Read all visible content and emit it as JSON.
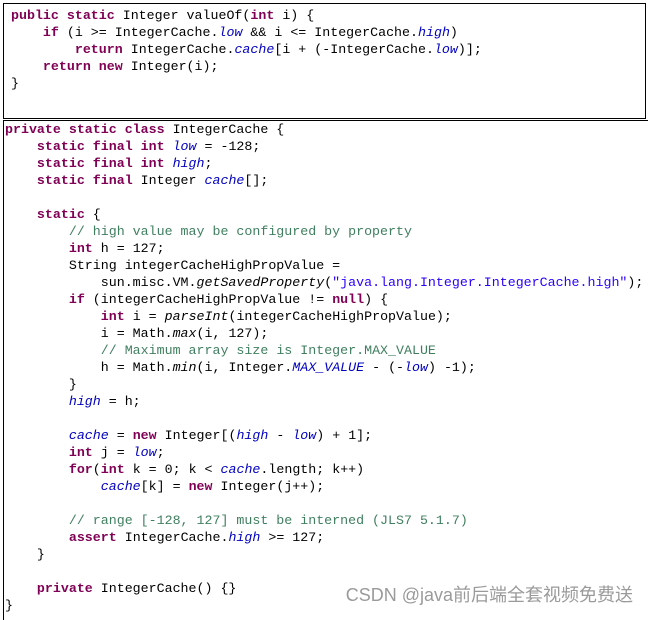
{
  "colors": {
    "keyword": "#7f0055",
    "field": "#0000c0",
    "comment": "#3f7f5f",
    "string": "#2a00ff"
  },
  "value_of_snippet": [
    [
      [
        "k",
        "public static "
      ],
      [
        "p",
        "Integer valueOf("
      ],
      [
        "k",
        "int"
      ],
      [
        "p",
        " i) {"
      ]
    ],
    [
      [
        "p",
        "    "
      ],
      [
        "k",
        "if"
      ],
      [
        "p",
        " (i >= IntegerCache."
      ],
      [
        "f",
        "low"
      ],
      [
        "p",
        " && i <= IntegerCache."
      ],
      [
        "f",
        "high"
      ],
      [
        "p",
        ")"
      ]
    ],
    [
      [
        "p",
        "        "
      ],
      [
        "k",
        "return"
      ],
      [
        "p",
        " IntegerCache."
      ],
      [
        "f",
        "cache"
      ],
      [
        "p",
        "[i + (-IntegerCache."
      ],
      [
        "f",
        "low"
      ],
      [
        "p",
        ")];"
      ]
    ],
    [
      [
        "p",
        "    "
      ],
      [
        "k",
        "return new"
      ],
      [
        "p",
        " Integer(i);"
      ]
    ],
    [
      [
        "p",
        "}"
      ]
    ]
  ],
  "integer_cache_snippet": [
    [
      [
        "k",
        "private static class"
      ],
      [
        "p",
        " IntegerCache {"
      ]
    ],
    [
      [
        "p",
        "    "
      ],
      [
        "k",
        "static final int "
      ],
      [
        "f",
        "low"
      ],
      [
        "p",
        " = -128;"
      ]
    ],
    [
      [
        "p",
        "    "
      ],
      [
        "k",
        "static final int "
      ],
      [
        "f",
        "high"
      ],
      [
        "p",
        ";"
      ]
    ],
    [
      [
        "p",
        "    "
      ],
      [
        "k",
        "static final "
      ],
      [
        "p",
        "Integer "
      ],
      [
        "f",
        "cache"
      ],
      [
        "p",
        "[];"
      ]
    ],
    [],
    [
      [
        "p",
        "    "
      ],
      [
        "k",
        "static"
      ],
      [
        "p",
        " {"
      ]
    ],
    [
      [
        "p",
        "        "
      ],
      [
        "c",
        "// high value may be configured by property"
      ]
    ],
    [
      [
        "p",
        "        "
      ],
      [
        "k",
        "int"
      ],
      [
        "p",
        " h = 127;"
      ]
    ],
    [
      [
        "p",
        "        String integerCacheHighPropValue ="
      ]
    ],
    [
      [
        "p",
        "            sun.misc.VM."
      ],
      [
        "m",
        "getSavedProperty"
      ],
      [
        "p",
        "("
      ],
      [
        "s",
        "\"java.lang.Integer.IntegerCache.high\""
      ],
      [
        "p",
        ");"
      ]
    ],
    [
      [
        "p",
        "        "
      ],
      [
        "k",
        "if"
      ],
      [
        "p",
        " (integerCacheHighPropValue != "
      ],
      [
        "k",
        "null"
      ],
      [
        "p",
        ") {"
      ]
    ],
    [
      [
        "p",
        "            "
      ],
      [
        "k",
        "int"
      ],
      [
        "p",
        " i = "
      ],
      [
        "m",
        "parseInt"
      ],
      [
        "p",
        "(integerCacheHighPropValue);"
      ]
    ],
    [
      [
        "p",
        "            i = Math."
      ],
      [
        "m",
        "max"
      ],
      [
        "p",
        "(i, 127);"
      ]
    ],
    [
      [
        "p",
        "            "
      ],
      [
        "c",
        "// Maximum array size is Integer.MAX_VALUE"
      ]
    ],
    [
      [
        "p",
        "            h = Math."
      ],
      [
        "m",
        "min"
      ],
      [
        "p",
        "(i, Integer."
      ],
      [
        "f",
        "MAX_VALUE"
      ],
      [
        "p",
        " - (-"
      ],
      [
        "f",
        "low"
      ],
      [
        "p",
        ") -1);"
      ]
    ],
    [
      [
        "p",
        "        }"
      ]
    ],
    [
      [
        "p",
        "        "
      ],
      [
        "f",
        "high"
      ],
      [
        "p",
        " = h;"
      ]
    ],
    [],
    [
      [
        "p",
        "        "
      ],
      [
        "f",
        "cache"
      ],
      [
        "p",
        " = "
      ],
      [
        "k",
        "new"
      ],
      [
        "p",
        " Integer[("
      ],
      [
        "f",
        "high"
      ],
      [
        "p",
        " - "
      ],
      [
        "f",
        "low"
      ],
      [
        "p",
        ") + 1];"
      ]
    ],
    [
      [
        "p",
        "        "
      ],
      [
        "k",
        "int"
      ],
      [
        "p",
        " j = "
      ],
      [
        "f",
        "low"
      ],
      [
        "p",
        ";"
      ]
    ],
    [
      [
        "p",
        "        "
      ],
      [
        "k",
        "for"
      ],
      [
        "p",
        "("
      ],
      [
        "k",
        "int"
      ],
      [
        "p",
        " k = 0; k < "
      ],
      [
        "f",
        "cache"
      ],
      [
        "p",
        ".length; k++)"
      ]
    ],
    [
      [
        "p",
        "            "
      ],
      [
        "f",
        "cache"
      ],
      [
        "p",
        "[k] = "
      ],
      [
        "k",
        "new"
      ],
      [
        "p",
        " Integer(j++);"
      ]
    ],
    [],
    [
      [
        "p",
        "        "
      ],
      [
        "c",
        "// range [-128, 127] must be interned (JLS7 5.1.7)"
      ]
    ],
    [
      [
        "p",
        "        "
      ],
      [
        "k",
        "assert"
      ],
      [
        "p",
        " IntegerCache."
      ],
      [
        "f",
        "high"
      ],
      [
        "p",
        " >= 127;"
      ]
    ],
    [
      [
        "p",
        "    }"
      ]
    ],
    [],
    [
      [
        "p",
        "    "
      ],
      [
        "k",
        "private"
      ],
      [
        "p",
        " IntegerCache() {}"
      ]
    ],
    [
      [
        "p",
        "}"
      ]
    ]
  ],
  "watermark": "CSDN @java前后端全套视频免费送"
}
